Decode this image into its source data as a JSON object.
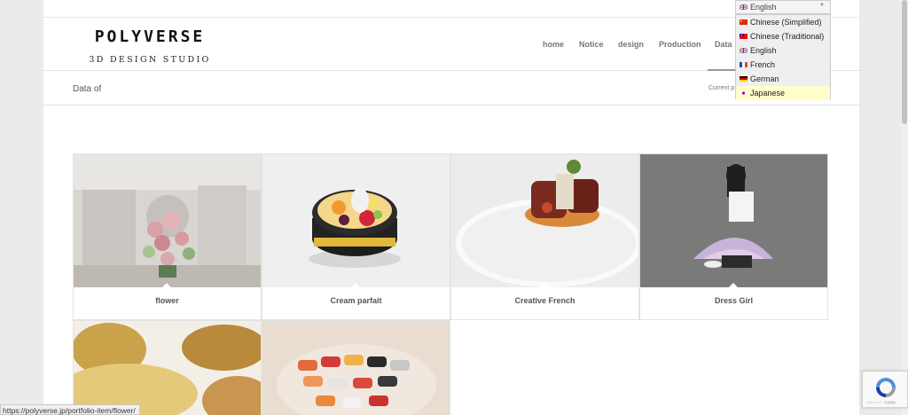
{
  "site": {
    "logo_name": "POLYVERSE",
    "logo_sub": "3D DESIGN STUDIO"
  },
  "nav": [
    "home",
    "Notice",
    "design",
    "Production",
    "Data"
  ],
  "titlebar": {
    "title": "Data of",
    "breadcrumb": "Current p"
  },
  "portfolio": [
    {
      "caption": "flower"
    },
    {
      "caption": "Cream parfait"
    },
    {
      "caption": "Creative French"
    },
    {
      "caption": "Dress Girl"
    },
    {
      "caption": ""
    },
    {
      "caption": ""
    }
  ],
  "language": {
    "selected": "English",
    "options": [
      "Chinese (Simplified)",
      "Chinese (Traditional)",
      "English",
      "French",
      "German",
      "Japanese"
    ],
    "highlighted": "Japanese"
  },
  "recaptcha": {
    "icon": "recaptcha-icon",
    "text": "プライバシー・利用規約"
  },
  "status": {
    "url": "https://polyverse.jp/portfolio-item/flower/"
  },
  "colors": {
    "accent": "#ffffcc",
    "nav_text": "#777777"
  }
}
